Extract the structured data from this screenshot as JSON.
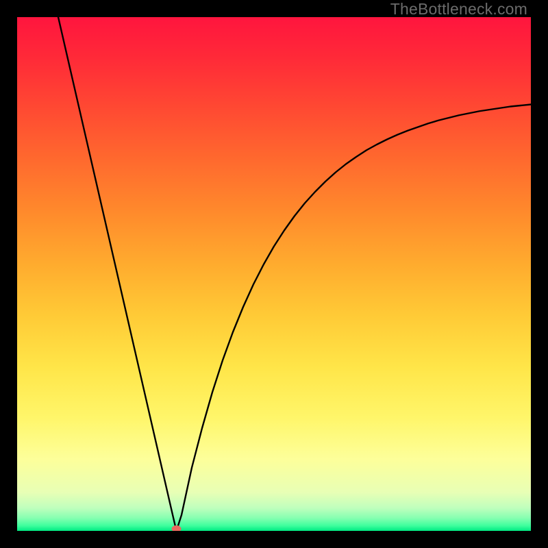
{
  "watermark": {
    "text": "TheBottleneck.com"
  },
  "chart_data": {
    "type": "line",
    "title": "",
    "xlabel": "",
    "ylabel": "",
    "xlim": [
      0,
      100
    ],
    "ylim": [
      0,
      100
    ],
    "grid": false,
    "background_gradient": {
      "stops": [
        {
          "offset": 0.0,
          "color": "#ff153e"
        },
        {
          "offset": 0.08,
          "color": "#ff2a38"
        },
        {
          "offset": 0.18,
          "color": "#ff4a32"
        },
        {
          "offset": 0.28,
          "color": "#ff6a2e"
        },
        {
          "offset": 0.38,
          "color": "#ff8a2c"
        },
        {
          "offset": 0.48,
          "color": "#ffab2e"
        },
        {
          "offset": 0.58,
          "color": "#ffca36"
        },
        {
          "offset": 0.68,
          "color": "#ffe548"
        },
        {
          "offset": 0.78,
          "color": "#fff66a"
        },
        {
          "offset": 0.86,
          "color": "#fdff9a"
        },
        {
          "offset": 0.925,
          "color": "#e8ffb5"
        },
        {
          "offset": 0.955,
          "color": "#c0ffbd"
        },
        {
          "offset": 0.975,
          "color": "#86ffb1"
        },
        {
          "offset": 0.99,
          "color": "#3dff9d"
        },
        {
          "offset": 1.0,
          "color": "#00e982"
        }
      ]
    },
    "curve": {
      "minimum_x": 31,
      "left_start": {
        "x": 8,
        "y": 100
      },
      "right_end": {
        "x": 100,
        "y": 83
      },
      "points": [
        {
          "x": 8,
          "y": 100.0
        },
        {
          "x": 10,
          "y": 91.3
        },
        {
          "x": 12,
          "y": 82.6
        },
        {
          "x": 14,
          "y": 73.9
        },
        {
          "x": 16,
          "y": 65.2
        },
        {
          "x": 18,
          "y": 56.5
        },
        {
          "x": 20,
          "y": 47.8
        },
        {
          "x": 22,
          "y": 39.1
        },
        {
          "x": 24,
          "y": 30.4
        },
        {
          "x": 26,
          "y": 21.7
        },
        {
          "x": 28,
          "y": 13.0
        },
        {
          "x": 30,
          "y": 4.3
        },
        {
          "x": 31,
          "y": 0.0
        },
        {
          "x": 32,
          "y": 3.1
        },
        {
          "x": 34,
          "y": 12.3
        },
        {
          "x": 36,
          "y": 20.0
        },
        {
          "x": 38,
          "y": 27.0
        },
        {
          "x": 40,
          "y": 33.2
        },
        {
          "x": 42,
          "y": 38.7
        },
        {
          "x": 44,
          "y": 43.6
        },
        {
          "x": 46,
          "y": 48.0
        },
        {
          "x": 48,
          "y": 51.9
        },
        {
          "x": 50,
          "y": 55.4
        },
        {
          "x": 52,
          "y": 58.5
        },
        {
          "x": 54,
          "y": 61.3
        },
        {
          "x": 56,
          "y": 63.8
        },
        {
          "x": 58,
          "y": 66.0
        },
        {
          "x": 60,
          "y": 68.0
        },
        {
          "x": 62,
          "y": 69.8
        },
        {
          "x": 64,
          "y": 71.4
        },
        {
          "x": 66,
          "y": 72.8
        },
        {
          "x": 68,
          "y": 74.1
        },
        {
          "x": 70,
          "y": 75.2
        },
        {
          "x": 72,
          "y": 76.2
        },
        {
          "x": 74,
          "y": 77.1
        },
        {
          "x": 76,
          "y": 77.9
        },
        {
          "x": 78,
          "y": 78.6
        },
        {
          "x": 80,
          "y": 79.3
        },
        {
          "x": 82,
          "y": 79.9
        },
        {
          "x": 84,
          "y": 80.4
        },
        {
          "x": 86,
          "y": 80.9
        },
        {
          "x": 88,
          "y": 81.3
        },
        {
          "x": 90,
          "y": 81.7
        },
        {
          "x": 92,
          "y": 82.0
        },
        {
          "x": 94,
          "y": 82.3
        },
        {
          "x": 96,
          "y": 82.6
        },
        {
          "x": 98,
          "y": 82.8
        },
        {
          "x": 100,
          "y": 83.0
        }
      ]
    },
    "marker": {
      "x": 31,
      "y": 0,
      "color": "#e86a5f",
      "rx": 7,
      "ry": 5
    }
  }
}
